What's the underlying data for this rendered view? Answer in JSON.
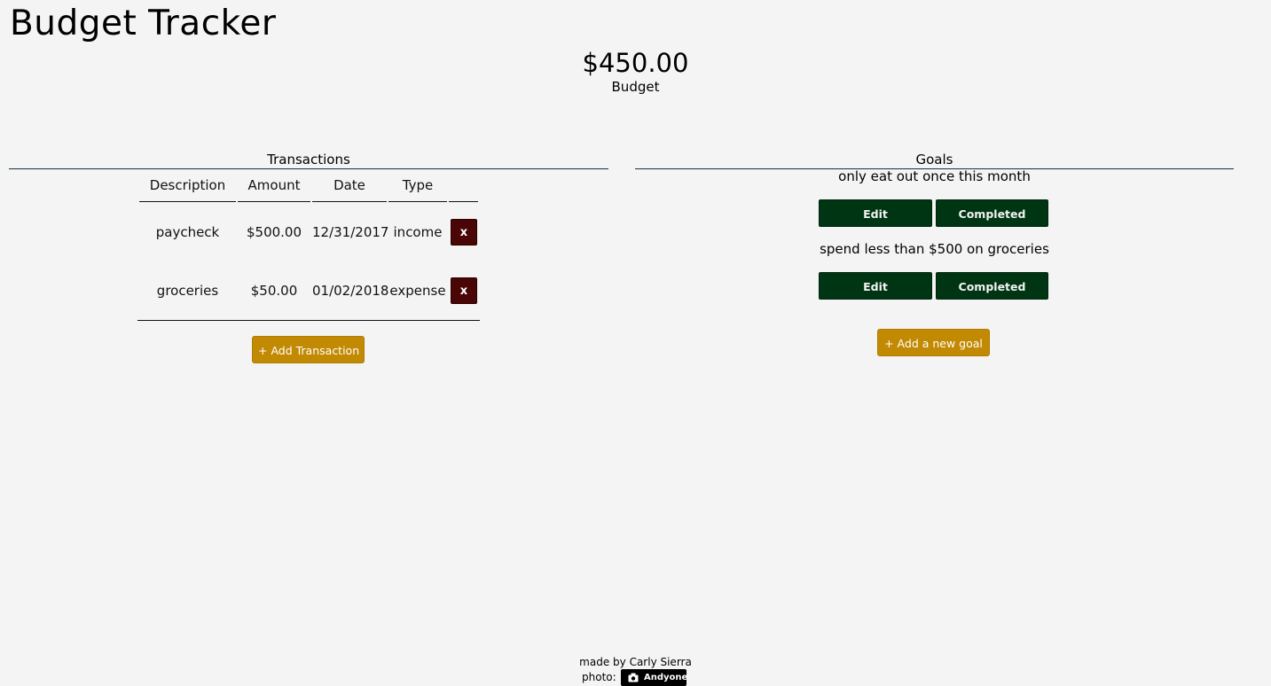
{
  "app": {
    "title": "Budget Tracker"
  },
  "budget": {
    "amount": "$450.00",
    "label": "Budget"
  },
  "transactions": {
    "title": "Transactions",
    "headers": [
      "Description",
      "Amount",
      "Date",
      "Type",
      ""
    ],
    "rows": [
      {
        "description": "paycheck",
        "amount": "$500.00",
        "date": "12/31/2017",
        "type": "income",
        "delete_label": "x"
      },
      {
        "description": "groceries",
        "amount": "$50.00",
        "date": "01/02/2018",
        "type": "expense",
        "delete_label": "x"
      }
    ],
    "add_label": "+ Add Transaction"
  },
  "goals": {
    "title": "Goals",
    "items": [
      {
        "text": "only eat out once this month",
        "edit_label": "Edit",
        "complete_label": "Completed"
      },
      {
        "text": "spend less than $500 on groceries",
        "edit_label": "Edit",
        "complete_label": "Completed"
      }
    ],
    "add_label": "+ Add a new goal"
  },
  "footer": {
    "credit": "made by Carly Sierra",
    "photo_label": "photo:",
    "photo_badge": "Andyone"
  },
  "colors": {
    "background": "#f4f4f4",
    "gold": "#c28a03",
    "green": "#003514",
    "maroon": "#4a0505",
    "rule": "#0f3440"
  }
}
